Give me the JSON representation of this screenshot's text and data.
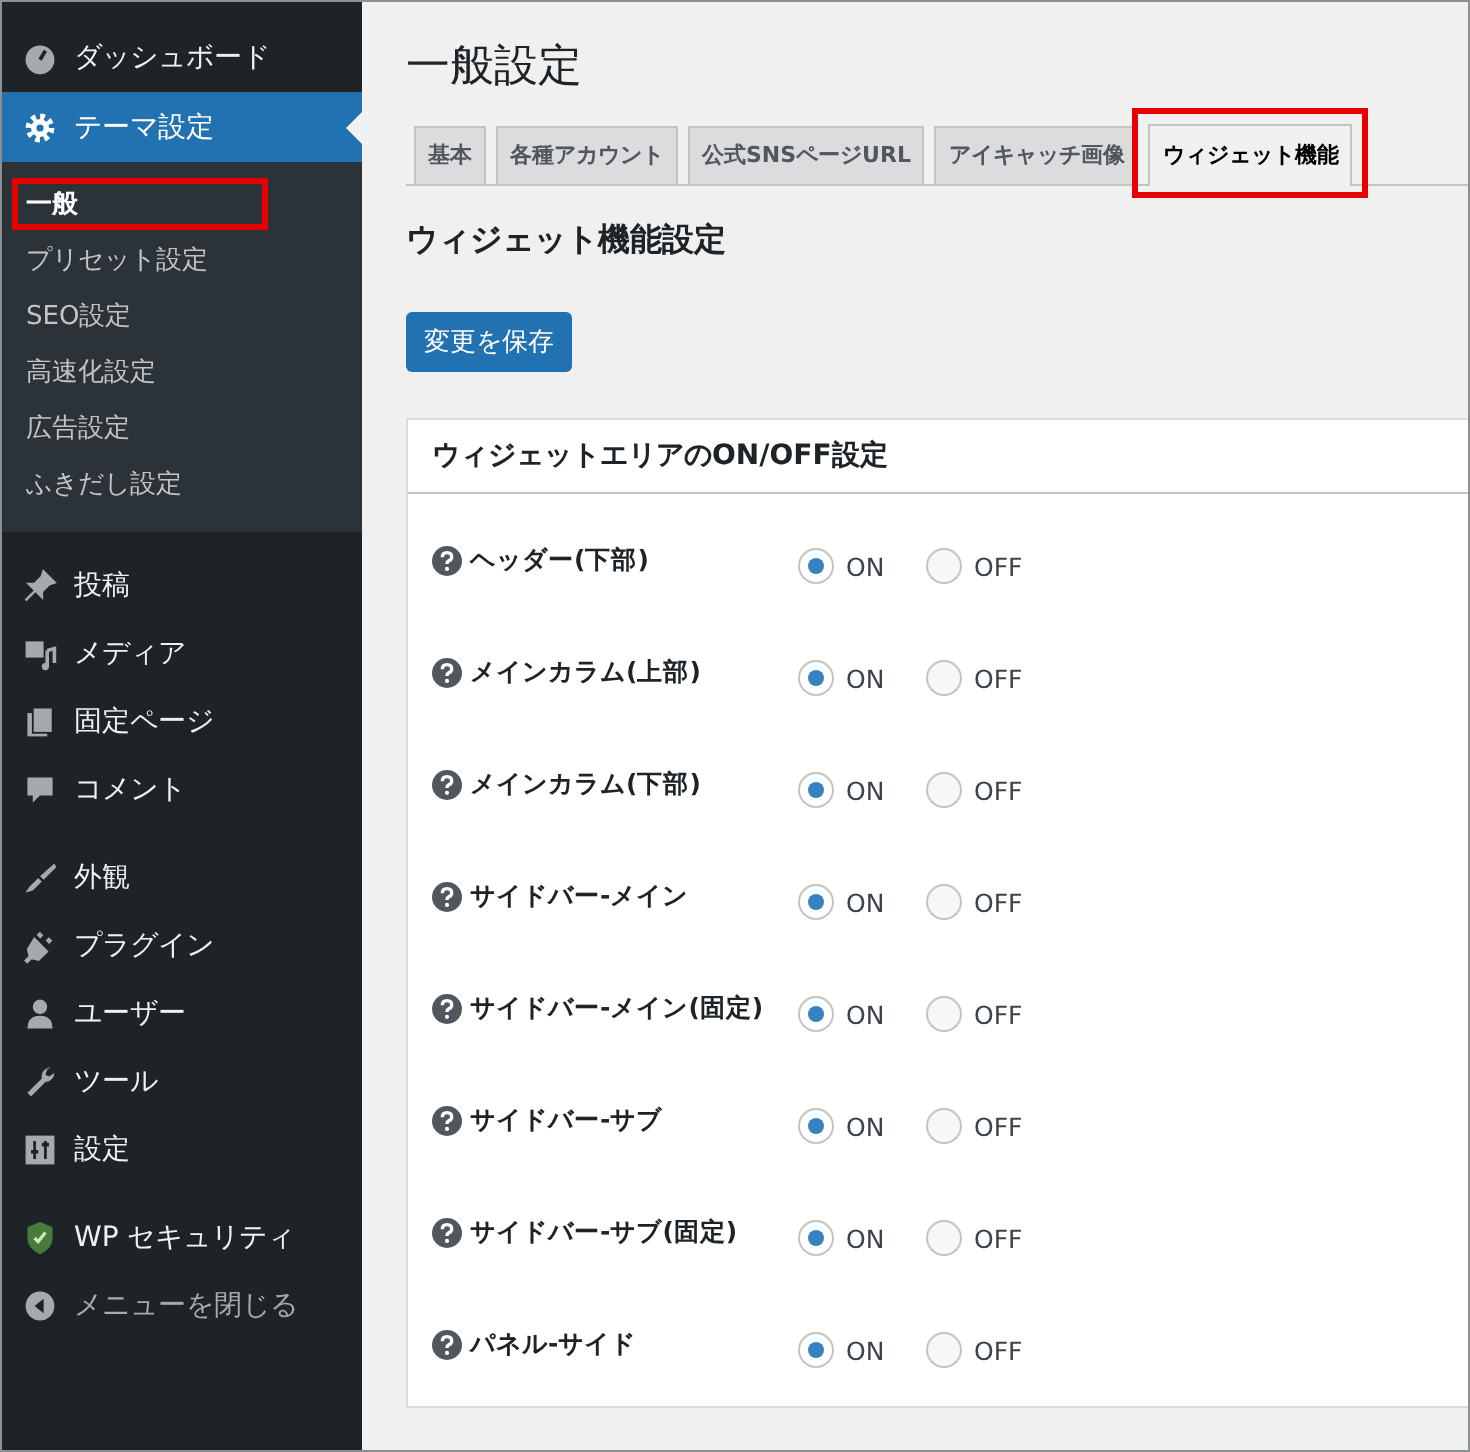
{
  "sidebar": {
    "groups": [
      [
        {
          "kind": "menu",
          "label": "ダッシュボード",
          "selected": false
        },
        {
          "kind": "menu",
          "label": "テーマ設定",
          "selected": true,
          "children": [
            {
              "label": "一般",
              "selected": true,
              "highlighted": true
            },
            {
              "label": "プリセット設定",
              "selected": false,
              "highlighted": false
            },
            {
              "label": "SEO設定",
              "selected": false,
              "highlighted": false
            },
            {
              "label": "高速化設定",
              "selected": false,
              "highlighted": false
            },
            {
              "label": "広告設定",
              "selected": false,
              "highlighted": false
            },
            {
              "label": "ふきだし設定",
              "selected": false,
              "highlighted": false
            }
          ]
        }
      ],
      [
        {
          "kind": "menu",
          "label": "投稿",
          "selected": false
        },
        {
          "kind": "menu",
          "label": "メディア",
          "selected": false
        },
        {
          "kind": "menu",
          "label": "固定ページ",
          "selected": false
        },
        {
          "kind": "menu",
          "label": "コメント",
          "selected": false
        }
      ],
      [
        {
          "kind": "menu",
          "label": "外観",
          "selected": false
        },
        {
          "kind": "menu",
          "label": "プラグイン",
          "selected": false
        },
        {
          "kind": "menu",
          "label": "ユーザー",
          "selected": false
        },
        {
          "kind": "menu",
          "label": "ツール",
          "selected": false
        },
        {
          "kind": "menu",
          "label": "設定",
          "selected": false
        }
      ],
      [
        {
          "kind": "menu",
          "label": "WP セキュリティ",
          "selected": false
        },
        {
          "kind": "collapse",
          "label": "メニューを閉じる"
        }
      ]
    ]
  },
  "main": {
    "title": "一般設定",
    "tabs": [
      {
        "label": "基本",
        "selected": false,
        "highlighted": false
      },
      {
        "label": "各種アカウント",
        "selected": false,
        "highlighted": false
      },
      {
        "label": "公式SNSページURL",
        "selected": false,
        "highlighted": false
      },
      {
        "label": "アイキャッチ画像",
        "selected": false,
        "highlighted": false
      },
      {
        "label": "ウィジェット機能",
        "selected": true,
        "highlighted": true
      }
    ],
    "section_title": "ウィジェット機能設定",
    "save_button": "変更を保存",
    "panel": {
      "title": "ウィジェットエリアのON/OFF設定",
      "rows": [
        {
          "label": "ヘッダー(下部)",
          "options": [
            {
              "label": "ON",
              "selected": true
            },
            {
              "label": "OFF",
              "selected": false
            }
          ]
        },
        {
          "label": "メインカラム(上部)",
          "options": [
            {
              "label": "ON",
              "selected": true
            },
            {
              "label": "OFF",
              "selected": false
            }
          ]
        },
        {
          "label": "メインカラム(下部)",
          "options": [
            {
              "label": "ON",
              "selected": true
            },
            {
              "label": "OFF",
              "selected": false
            }
          ]
        },
        {
          "label": "サイドバー-メイン",
          "options": [
            {
              "label": "ON",
              "selected": true
            },
            {
              "label": "OFF",
              "selected": false
            }
          ]
        },
        {
          "label": "サイドバー-メイン(固定)",
          "options": [
            {
              "label": "ON",
              "selected": true
            },
            {
              "label": "OFF",
              "selected": false
            }
          ]
        },
        {
          "label": "サイドバー-サブ",
          "options": [
            {
              "label": "ON",
              "selected": true
            },
            {
              "label": "OFF",
              "selected": false
            }
          ]
        },
        {
          "label": "サイドバー-サブ(固定)",
          "options": [
            {
              "label": "ON",
              "selected": true
            },
            {
              "label": "OFF",
              "selected": false
            }
          ]
        },
        {
          "label": "パネル-サイド",
          "options": [
            {
              "label": "ON",
              "selected": true
            },
            {
              "label": "OFF",
              "selected": false
            }
          ]
        }
      ]
    }
  }
}
